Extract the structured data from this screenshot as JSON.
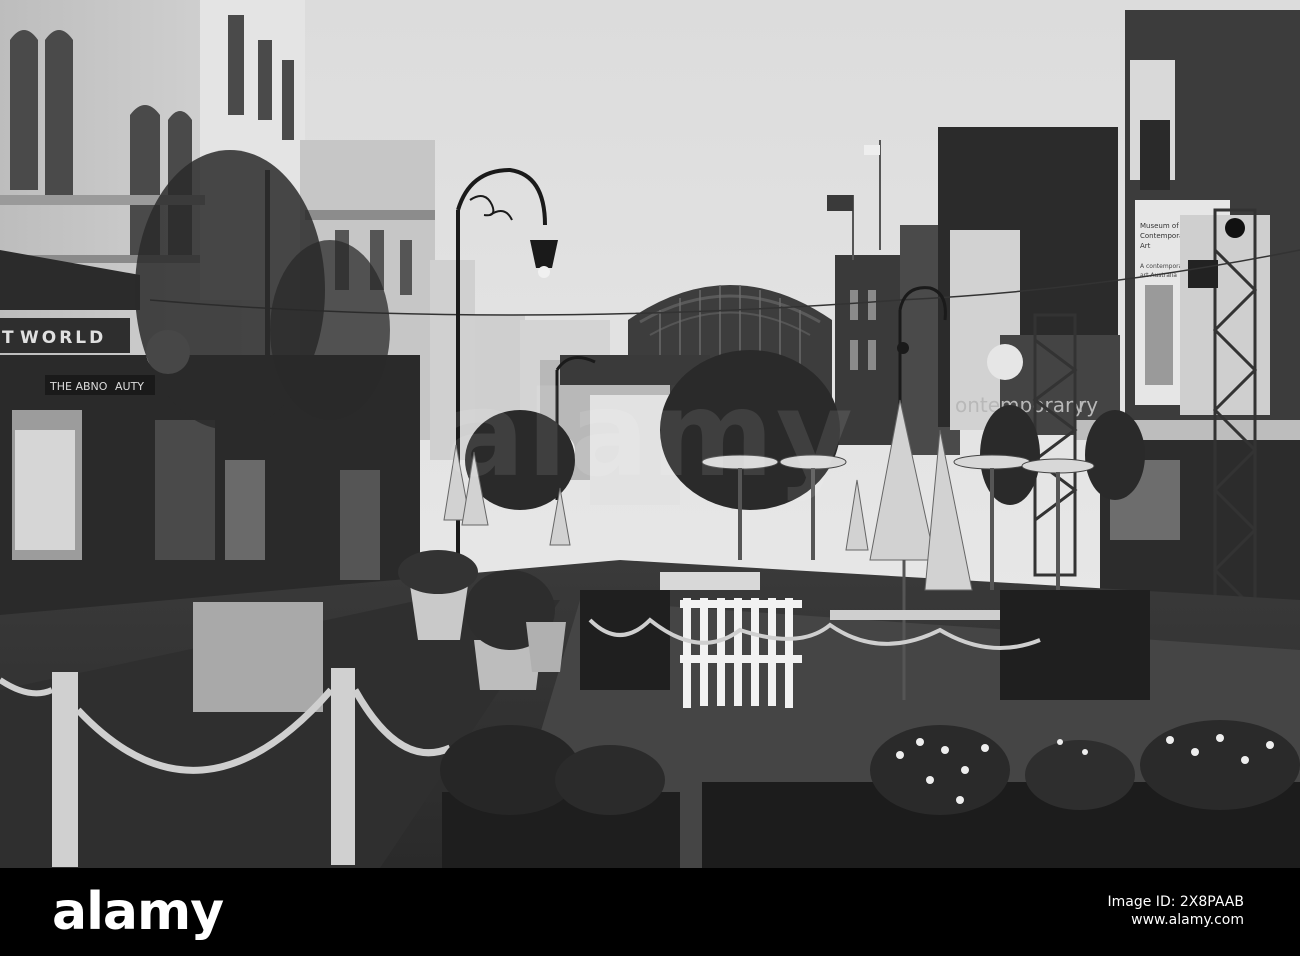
{
  "photo": {
    "shop_sign_left": "WORLD",
    "shop_sign_left_partial": "T",
    "shop_sign_lower": "THE ABNO",
    "shop_sign_lower_tail": "AUTY",
    "museum_sign": "ontemporary",
    "museum_sign_tail": "ry",
    "banner_text_1": "Museum of",
    "banner_text_2": "Contemporary",
    "banner_text_3": "Art",
    "banner_text_4": "A contemporary",
    "banner_text_5": "art Australia"
  },
  "watermark": {
    "text": "alamy"
  },
  "footer": {
    "logo": "alamy",
    "caption_line": "Image ID: 2X8PAAB",
    "site": "www.alamy.com"
  }
}
